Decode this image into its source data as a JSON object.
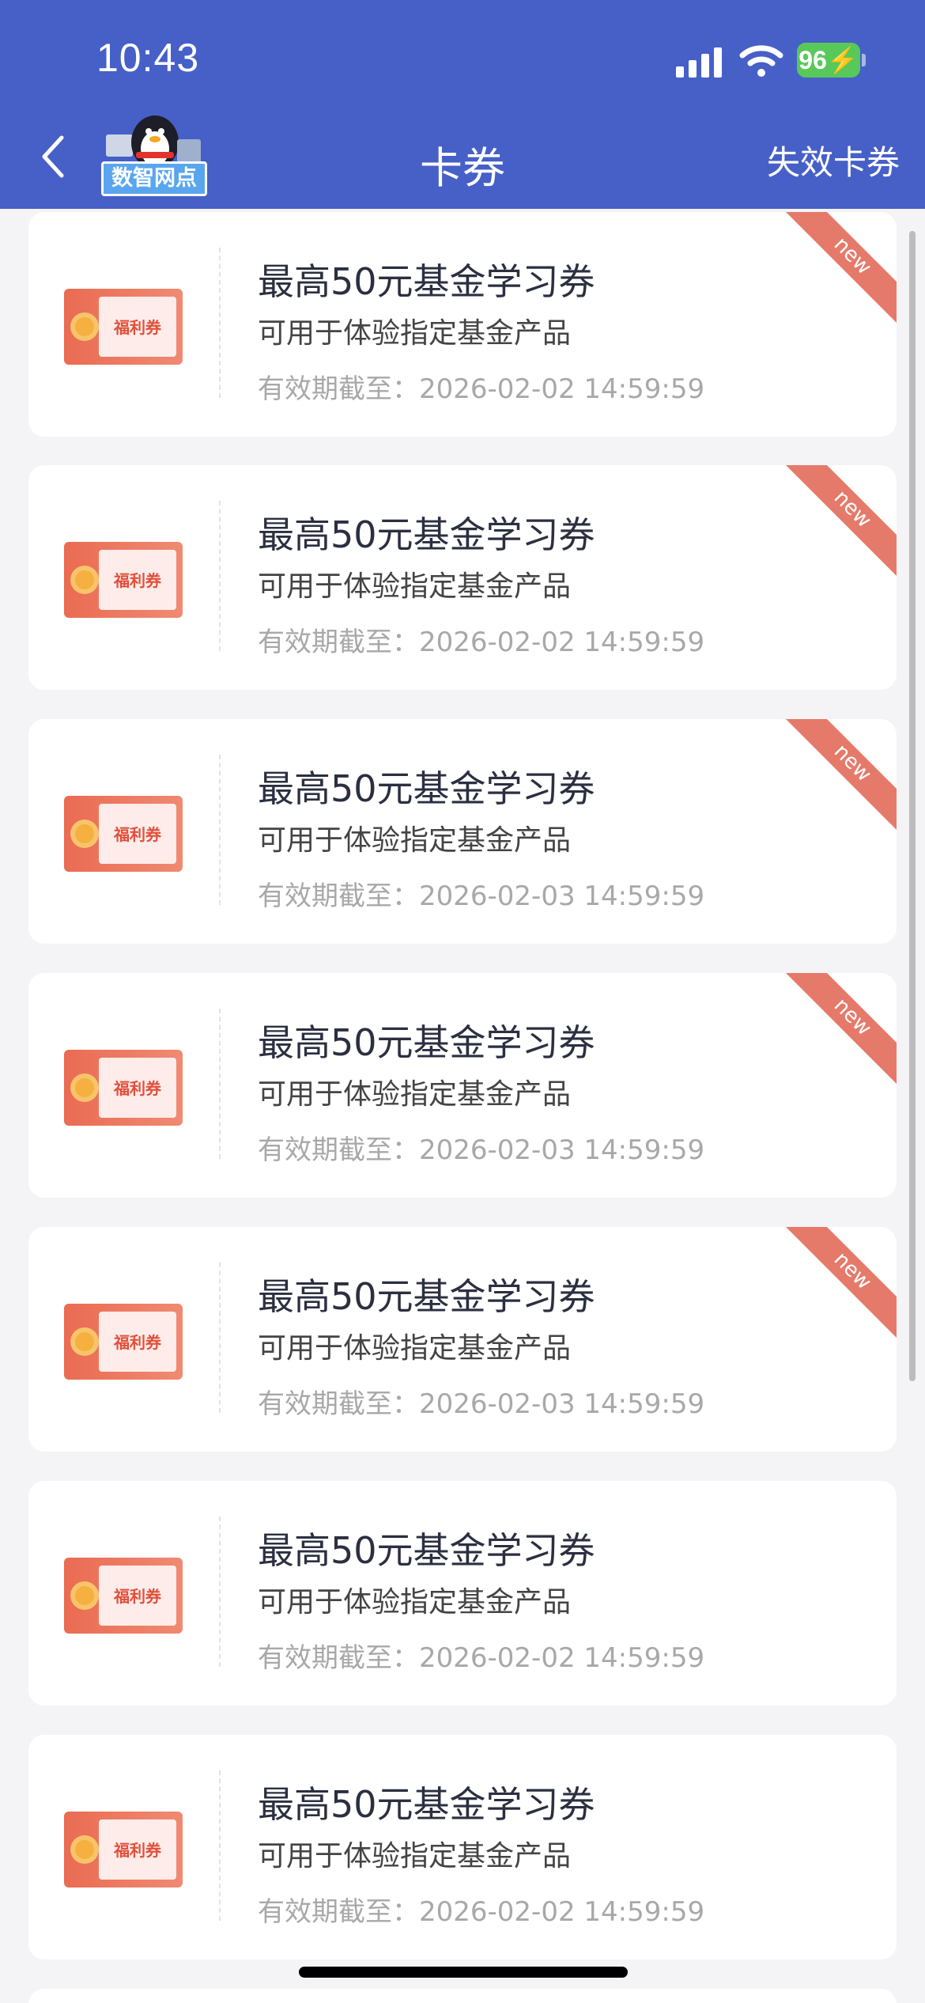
{
  "status_bar": {
    "time": "10:43",
    "battery": "96"
  },
  "nav": {
    "title": "卡券",
    "right_label": "失效卡券",
    "mascot_badge": "数智网点"
  },
  "coupons": [
    {
      "ticket_label": "福利券",
      "title": "最高50元基金学习券",
      "description": "可用于体验指定基金产品",
      "expiry": "有效期截至：2026-02-02 14:59:59",
      "badge": "new"
    },
    {
      "ticket_label": "福利券",
      "title": "最高50元基金学习券",
      "description": "可用于体验指定基金产品",
      "expiry": "有效期截至：2026-02-02 14:59:59",
      "badge": "new"
    },
    {
      "ticket_label": "福利券",
      "title": "最高50元基金学习券",
      "description": "可用于体验指定基金产品",
      "expiry": "有效期截至：2026-02-03 14:59:59",
      "badge": "new"
    },
    {
      "ticket_label": "福利券",
      "title": "最高50元基金学习券",
      "description": "可用于体验指定基金产品",
      "expiry": "有效期截至：2026-02-03 14:59:59",
      "badge": "new"
    },
    {
      "ticket_label": "福利券",
      "title": "最高50元基金学习券",
      "description": "可用于体验指定基金产品",
      "expiry": "有效期截至：2026-02-03 14:59:59",
      "badge": "new"
    },
    {
      "ticket_label": "福利券",
      "title": "最高50元基金学习券",
      "description": "可用于体验指定基金产品",
      "expiry": "有效期截至：2026-02-02 14:59:59",
      "badge": ""
    },
    {
      "ticket_label": "福利券",
      "title": "最高50元基金学习券",
      "description": "可用于体验指定基金产品",
      "expiry": "有效期截至：2026-02-02 14:59:59",
      "badge": ""
    }
  ],
  "colors": {
    "header": "#4660c8",
    "ribbon": "#e57a6a",
    "ticket": "#ea6b52"
  },
  "icons": {
    "back": "chevron-left-icon",
    "signal": "cellular-signal-icon",
    "wifi": "wifi-icon",
    "battery": "battery-icon",
    "ticket": "coupon-ticket-icon",
    "mascot": "penguin-mascot-icon"
  }
}
